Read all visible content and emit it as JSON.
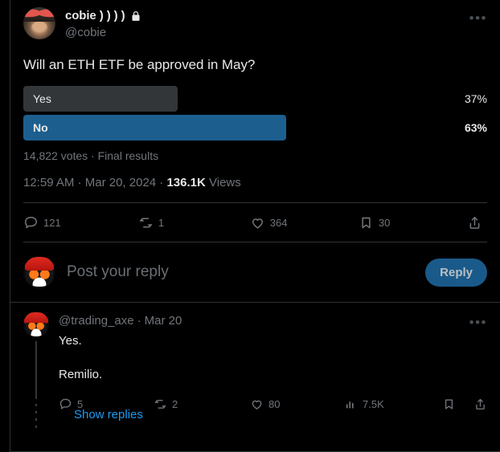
{
  "post": {
    "display_name": "cobie ) ) ) )",
    "badge_icon": "lock-icon",
    "handle": "@cobie",
    "more_label": "•••",
    "text": "Will an ETH ETF be approved in May?",
    "poll": {
      "options": [
        {
          "label": "Yes",
          "percent": "37%",
          "fill": 37,
          "winner": false
        },
        {
          "label": "No",
          "percent": "63%",
          "fill": 63,
          "winner": true
        }
      ],
      "meta": "14,822 votes · Final results"
    },
    "timestamp": {
      "time": "12:59 AM",
      "sep1": " · ",
      "date": "Mar 20, 2024",
      "sep2": " · ",
      "views_count": "136.1K",
      "views_label": " Views"
    },
    "actions": {
      "replies": "121",
      "reposts": "1",
      "likes": "364",
      "bookmarks": "30",
      "share": ""
    }
  },
  "composer": {
    "placeholder": "Post your reply",
    "button_label": "Reply"
  },
  "reply": {
    "handle": "@trading_axe",
    "separator": "·",
    "date": "Mar 20",
    "more_label": "•••",
    "line1": "Yes.",
    "line2": "Remilio.",
    "actions": {
      "replies": "5",
      "reposts": "2",
      "likes": "80",
      "views": "7.5K"
    },
    "show_replies_label": "Show replies"
  },
  "colors": {
    "background": "#000000",
    "text": "#e7e9ea",
    "muted": "#71767b",
    "link": "#1d9bf0",
    "poll_winner": "#1c5f8f",
    "poll_loser": "#333639",
    "reply_button": "#1a5a8a",
    "border": "#2f3336"
  }
}
